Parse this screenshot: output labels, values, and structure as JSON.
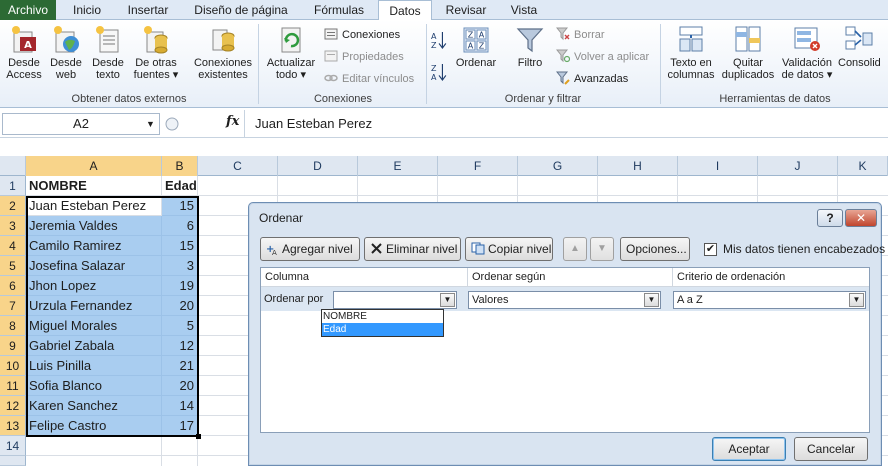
{
  "ribbon": {
    "tabs": [
      "Archivo",
      "Inicio",
      "Insertar",
      "Diseño de página",
      "Fórmulas",
      "Datos",
      "Revisar",
      "Vista"
    ],
    "active_tab": "Datos",
    "groups": {
      "external": {
        "label": "Obtener datos externos",
        "access": [
          "Desde",
          "Access"
        ],
        "web": [
          "Desde",
          "web"
        ],
        "text": [
          "Desde",
          "texto"
        ],
        "other": [
          "De otras",
          "fuentes ▾"
        ],
        "existing": [
          "Conexiones",
          "existentes"
        ]
      },
      "connections": {
        "label": "Conexiones",
        "refresh": [
          "Actualizar",
          "todo ▾"
        ],
        "connections": "Conexiones",
        "properties": "Propiedades",
        "edit_links": "Editar vínculos"
      },
      "sort_filter": {
        "label": "Ordenar y filtrar",
        "sort": "Ordenar",
        "filter": "Filtro",
        "clear": "Borrar",
        "reapply": "Volver a aplicar",
        "advanced": "Avanzadas"
      },
      "data_tools": {
        "label": "Herramientas de datos",
        "text_to_columns": [
          "Texto en",
          "columnas"
        ],
        "remove_duplicates": [
          "Quitar",
          "duplicados"
        ],
        "validation": [
          "Validación",
          "de datos ▾"
        ],
        "consolidate": "Consolid"
      }
    }
  },
  "formula_bar": {
    "name_box": "A2",
    "fx": "fx",
    "content": "Juan Esteban Perez"
  },
  "sheet": {
    "columns": [
      "A",
      "B",
      "C",
      "D",
      "E",
      "F",
      "G",
      "H",
      "I",
      "J",
      "K"
    ],
    "rows": [
      "1",
      "2",
      "3",
      "4",
      "5",
      "6",
      "7",
      "8",
      "9",
      "10",
      "11",
      "12",
      "13",
      "14"
    ],
    "header": [
      "NOMBRE",
      "Edad"
    ],
    "data": [
      {
        "name": "Juan Esteban Perez",
        "age": "15"
      },
      {
        "name": "Jeremia Valdes",
        "age": "6"
      },
      {
        "name": "Camilo Ramirez",
        "age": "15"
      },
      {
        "name": "Josefina Salazar",
        "age": "3"
      },
      {
        "name": "Jhon Lopez",
        "age": "19"
      },
      {
        "name": "Urzula Fernandez",
        "age": "20"
      },
      {
        "name": "Miguel Morales",
        "age": "5"
      },
      {
        "name": "Gabriel Zabala",
        "age": "12"
      },
      {
        "name": "Luis Pinilla",
        "age": "21"
      },
      {
        "name": "Sofia Blanco",
        "age": "20"
      },
      {
        "name": "Karen Sanchez",
        "age": "14"
      },
      {
        "name": "Felipe Castro",
        "age": "17"
      }
    ]
  },
  "dialog": {
    "title": "Ordenar",
    "help": "?",
    "close": "✕",
    "add_level": "Agregar nivel",
    "delete_level": "Eliminar nivel",
    "copy_level": "Copiar nivel",
    "options": "Opciones...",
    "has_headers": "Mis datos tienen encabezados",
    "headers": {
      "column": "Columna",
      "sort_on": "Ordenar según",
      "order": "Criterio de ordenación"
    },
    "row": {
      "label": "Ordenar por",
      "column_value": "",
      "sort_on_value": "Valores",
      "order_value": "A a Z"
    },
    "dropdown_options": [
      "NOMBRE",
      "Edad"
    ],
    "dropdown_selected": "Edad",
    "ok": "Aceptar",
    "cancel": "Cancelar"
  }
}
